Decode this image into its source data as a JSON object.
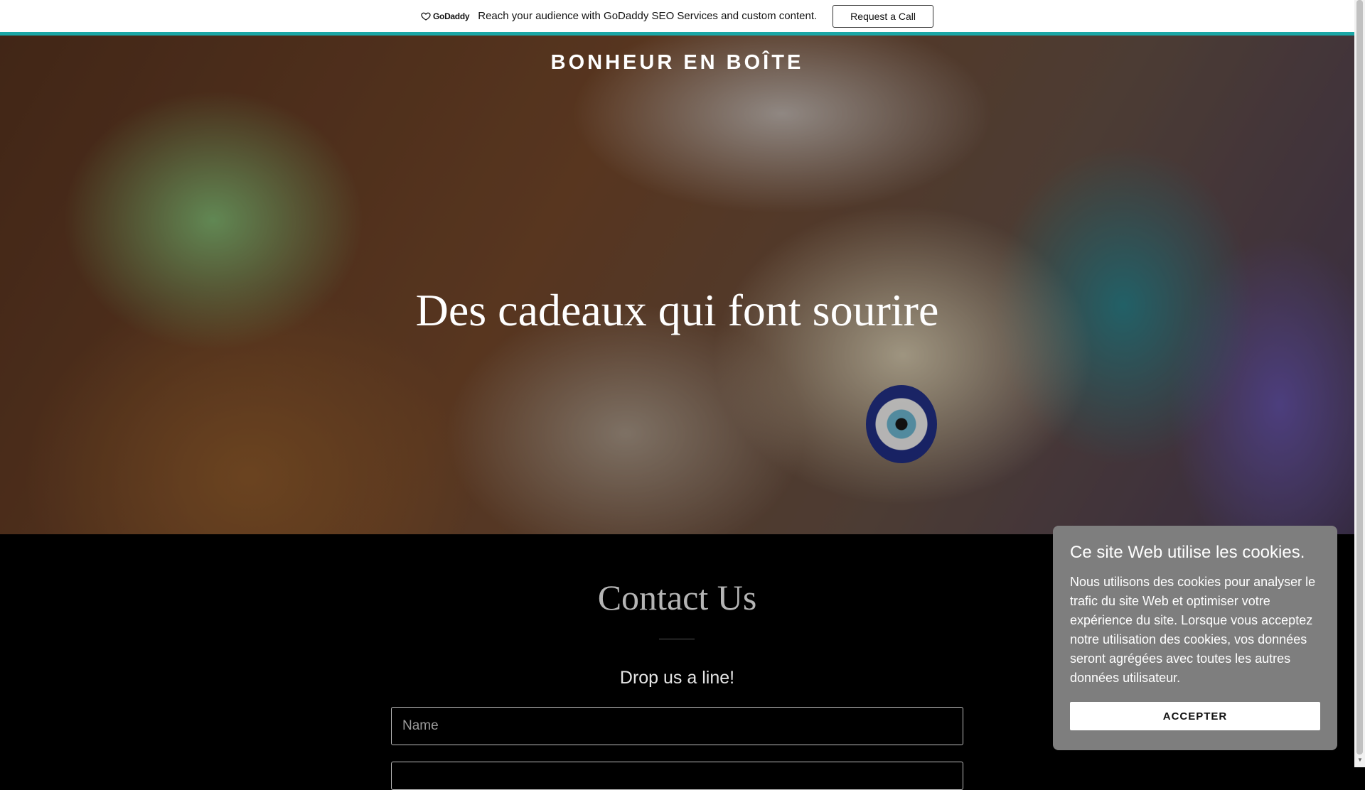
{
  "promo": {
    "logo_text": "GoDaddy",
    "message": "Reach your audience with GoDaddy SEO Services and custom content.",
    "button_label": "Request a Call",
    "accent_color": "#1aa7a6"
  },
  "hero": {
    "site_name": "BONHEUR EN BOÎTE",
    "tagline": "Des cadeaux qui font sourire"
  },
  "contact": {
    "title": "Contact Us",
    "subtitle": "Drop us a line!",
    "name_placeholder": "Name"
  },
  "cookie": {
    "title": "Ce site Web utilise les cookies.",
    "body": "Nous utilisons des cookies pour analyser le trafic du site Web et optimiser votre expérience du site. Lorsque vous acceptez notre utilisation des cookies, vos données seront agrégées avec toutes les autres données utilisateur.",
    "accept_label": "ACCEPTER"
  }
}
